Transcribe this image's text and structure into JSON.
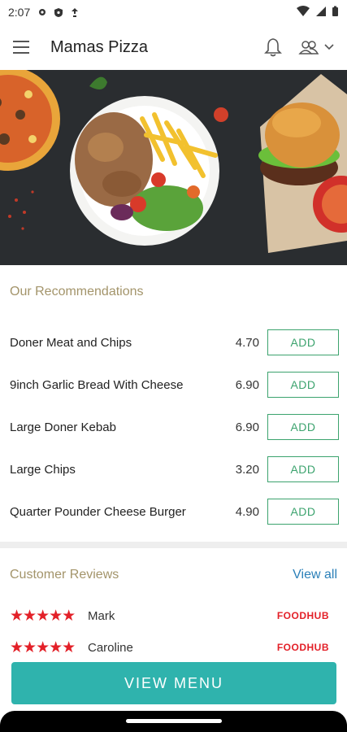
{
  "status_bar": {
    "time": "2:07"
  },
  "app_bar": {
    "title": "Mamas Pizza"
  },
  "hero": {
    "description": "food banner"
  },
  "recommendations": {
    "title": "Our Recommendations",
    "add_label": "ADD",
    "items": [
      {
        "name": "Doner Meat and Chips",
        "price": "4.70"
      },
      {
        "name": "9inch Garlic Bread With Cheese",
        "price": "6.90"
      },
      {
        "name": "Large Doner Kebab",
        "price": "6.90"
      },
      {
        "name": "Large Chips",
        "price": "3.20"
      },
      {
        "name": "Quarter Pounder Cheese Burger",
        "price": "4.90"
      }
    ]
  },
  "reviews": {
    "title": "Customer Reviews",
    "view_all": "View all",
    "items": [
      {
        "stars": "★★★★★",
        "name": "Mark",
        "source": "FOODHUB"
      },
      {
        "stars": "★★★★★",
        "name": "Caroline",
        "source": "FOODHUB"
      }
    ]
  },
  "cta": {
    "label": "VIEW MENU"
  },
  "colors": {
    "accent": "#2fb3ad",
    "add_green": "#3ca36e",
    "section_title": "#a3946a",
    "star_red": "#e32028",
    "link_blue": "#2a7fb8"
  }
}
